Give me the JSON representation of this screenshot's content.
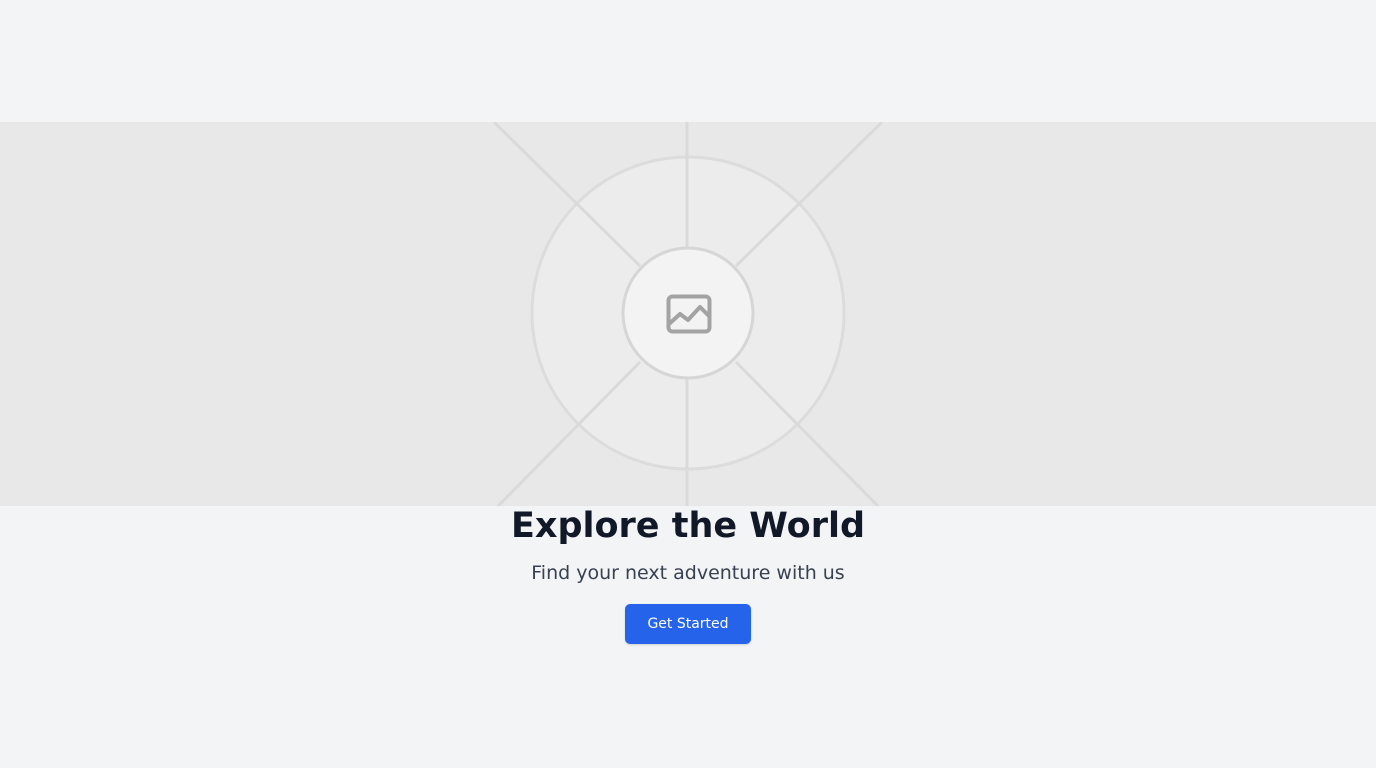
{
  "hero": {
    "title": "Explore the World",
    "subtitle": "Find your next adventure with us",
    "cta_label": "Get Started",
    "image_icon": "image-placeholder-icon"
  },
  "colors": {
    "page_background": "#f3f4f6",
    "image_background": "#e8e8e8",
    "title": "#111827",
    "subtitle": "#374151",
    "button": "#2563eb",
    "button_text": "#ffffff"
  }
}
